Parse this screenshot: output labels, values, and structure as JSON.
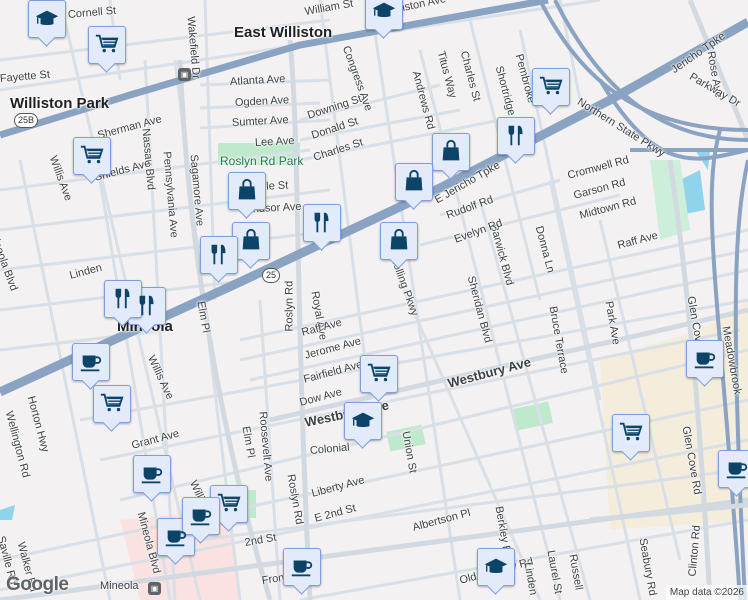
{
  "map": {
    "attribution": "Map data ©2026",
    "logo": "Google",
    "colors": {
      "highway": "#8aa3c2",
      "road": "#d7dde4",
      "park": "#bfe9cc",
      "water": "#8fd3ec",
      "commercial": "#f5eddc",
      "pin_bg": "#e3ebfb",
      "pin_icon": "#0b4467"
    },
    "shields": [
      "25B",
      "25"
    ],
    "labels": [
      "William St",
      "East Williston",
      "E Williston Ave",
      "Atlanta Ave",
      "Ogden Ave",
      "Sumter Ave",
      "Lee Ave",
      "Downing St",
      "Donald St",
      "Charles St",
      "Congress Ave",
      "Andrews Rd",
      "Titus Way",
      "Charles St",
      "Shortridge Dr",
      "Pembroke",
      "Northern State Pkwy",
      "Jericho Tpke",
      "Rose Ave",
      "Parkway Dr",
      "Cromwell Rd",
      "Garson Rd",
      "Midtown Rd",
      "Raff Ave",
      "Glen Cove Rd",
      "Meadowbrook",
      "Donna Ln",
      "Barwick Blvd",
      "Sheridan Blvd",
      "Rudolf Rd",
      "Evelyn Rd",
      "E Jericho Tpke",
      "Bruce Terrace",
      "Park Ave",
      "Williston Park",
      "Willis Ave",
      "Nassau Blvd",
      "Pennsylvania Ave",
      "Sagamore Ave",
      "Mineola Blvd",
      "Roslyn Rd Park",
      "Lavelle St",
      "Windsor Ave",
      "Shields Ave",
      "Sherman Ave",
      "Royal Ave",
      "Roslyn Rd",
      "Elm Pl",
      "Raff Ave",
      "Jerome Ave",
      "Fairfield Ave",
      "Dow Ave",
      "Westbury Ave",
      "Westbury Ave",
      "Colonial",
      "Union St",
      "Mineola",
      "Willis Ave",
      "Willis Ave",
      "Elm Pl",
      "Roosevelt Ave",
      "Roslyn Rd",
      "Grant Ave",
      "Horton Hwy",
      "Wellington Rd",
      "Liberty Ave",
      "E 2nd St",
      "2nd St",
      "Albertson Pl",
      "Berkley Rd",
      "Old Country Rd",
      "Russell",
      "Laurel St",
      "Linden",
      "Seabury Rd",
      "Clinton Rd",
      "Mineola",
      "Glen Cove Rd",
      "Mineola Blvd",
      "Walker Rd",
      "Saville Rd",
      "Front St",
      "Linden",
      "Fayette St",
      "Cornell St",
      "Wakefield Dr",
      "Rolling Pkwy"
    ],
    "stations": [
      "East Williston",
      "Mineola"
    ],
    "pins": [
      "school",
      "school",
      "school",
      "school",
      "shopping-cart",
      "shopping-cart",
      "shopping-cart",
      "shopping-cart",
      "shopping-cart",
      "shopping-cart",
      "shopping-cart",
      "coffee",
      "coffee",
      "coffee",
      "coffee",
      "coffee",
      "coffee",
      "coffee",
      "shopping-bag",
      "shopping-bag",
      "shopping-bag",
      "shopping-bag",
      "shopping-bag",
      "restaurant",
      "restaurant",
      "restaurant",
      "restaurant",
      "restaurant"
    ]
  }
}
